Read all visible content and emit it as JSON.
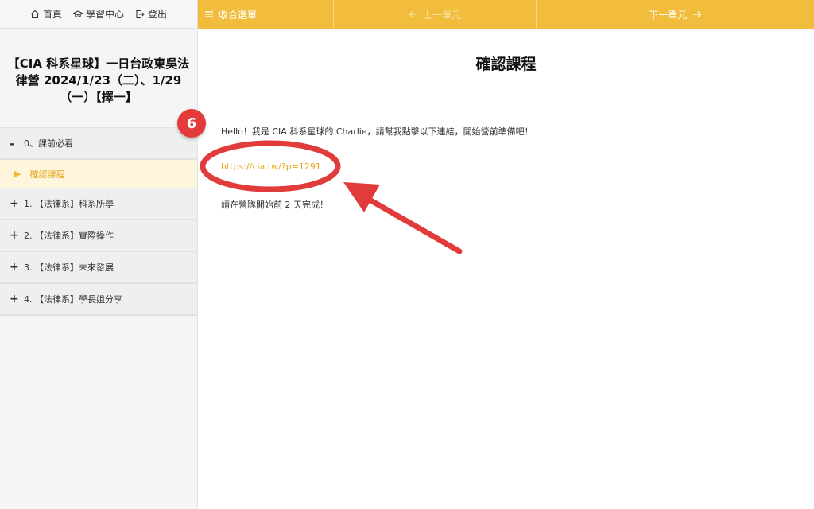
{
  "topnav": {
    "home_label": "首頁",
    "learning_label": "學習中心",
    "logout_label": "登出"
  },
  "course": {
    "title": "【CIA 科系星球】一日台政東吳法律營 2024/1/23（二）、1/29（一）【擇一】"
  },
  "sidebar": {
    "sections": [
      {
        "sign": "-",
        "label": "0、課前必看"
      },
      {
        "sign": "+",
        "label": "1. 【法律系】科系所學"
      },
      {
        "sign": "+",
        "label": "2. 【法律系】實際操作"
      },
      {
        "sign": "+",
        "label": "3. 【法律系】未來發展"
      },
      {
        "sign": "+",
        "label": "4. 【法律系】學長姐分享"
      }
    ],
    "active_lesson": "確認課程"
  },
  "toolbar": {
    "menu_label": "收合選單",
    "prev_label": "上一單元",
    "next_label": "下一單元"
  },
  "main": {
    "title": "確認課程",
    "intro": "Hello！我是 CIA 科系星球的 Charlie，請幫我點擊以下連結，開始營前準備吧！",
    "link": "https://cia.tw/?p=1291",
    "note": "請在營隊開始前 2 天完成！"
  },
  "annotation": {
    "badge_number": "6",
    "color": "#e23b3b"
  },
  "colors": {
    "accent": "#f2bd3c",
    "link": "#e8a718",
    "annotation": "#e23b3b"
  }
}
